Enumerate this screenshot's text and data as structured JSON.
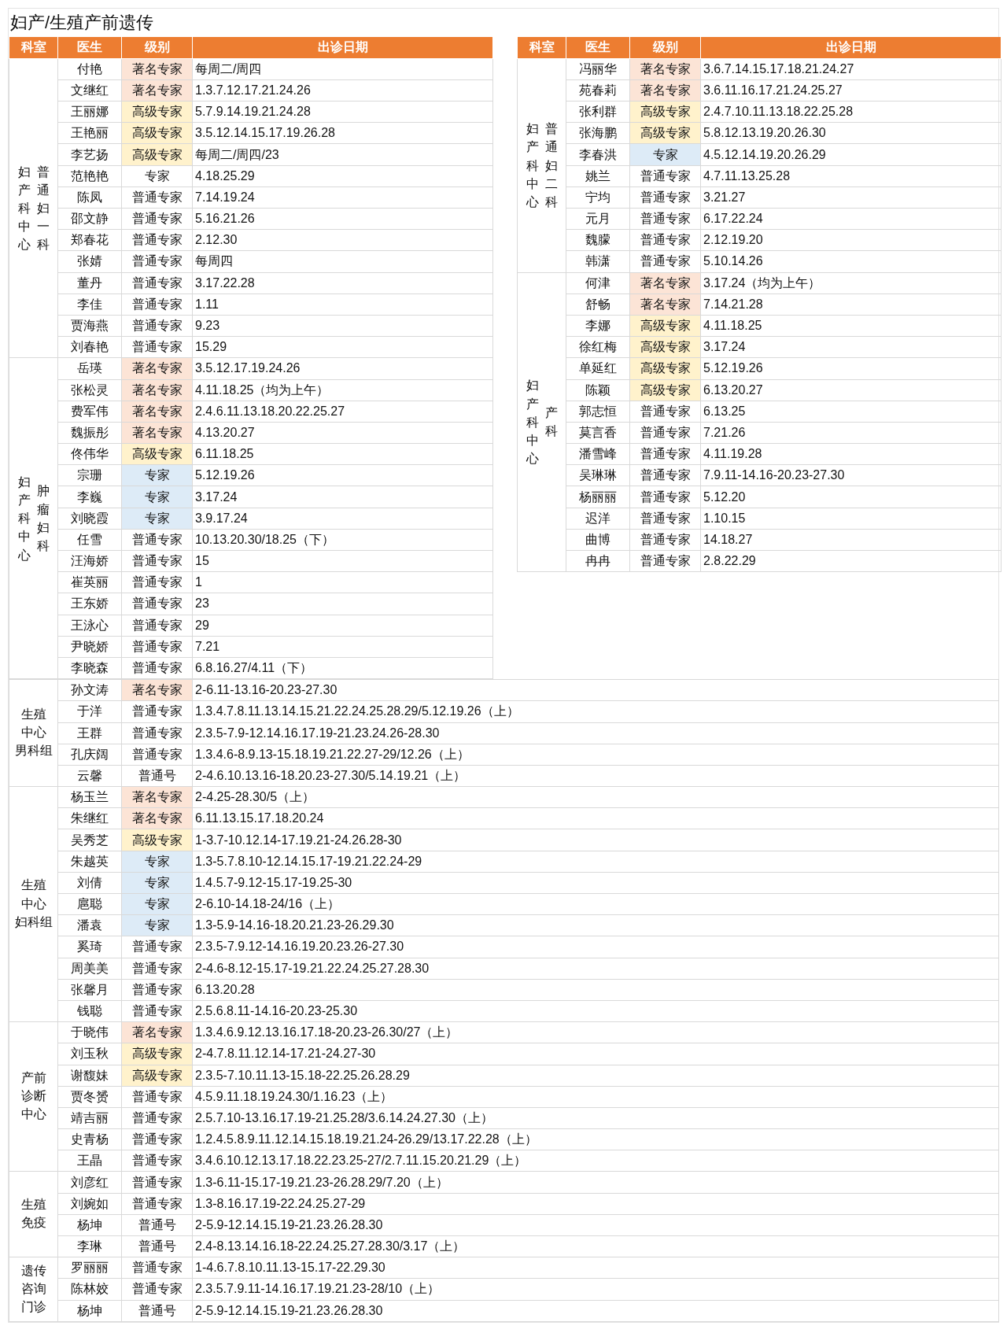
{
  "title": "妇产/生殖产前遗传",
  "top_tables": [
    {
      "columns": [
        "科室",
        "医生",
        "级别",
        "出诊日期"
      ],
      "sections": [
        {
          "department": {
            "kind": "vertical",
            "lines": [
              "妇产科中心",
              "普通妇一科"
            ]
          },
          "doctors": [
            {
              "name": "付艳",
              "grade": "著名专家",
              "color": "#fce4d6",
              "dates": "每周二/周四"
            },
            {
              "name": "文继红",
              "grade": "著名专家",
              "color": "#fce4d6",
              "dates": "1.3.7.12.17.21.24.26"
            },
            {
              "name": "王丽娜",
              "grade": "高级专家",
              "color": "#fff2cc",
              "dates": "5.7.9.14.19.21.24.28"
            },
            {
              "name": "王艳丽",
              "grade": "高级专家",
              "color": "#fff2cc",
              "dates": "3.5.12.14.15.17.19.26.28"
            },
            {
              "name": "李艺扬",
              "grade": "高级专家",
              "color": "#fff2cc",
              "dates": "每周二/周四/23"
            },
            {
              "name": "范艳艳",
              "grade": "专家",
              "dates": "4.18.25.29"
            },
            {
              "name": "陈凤",
              "grade": "普通专家",
              "dates": "7.14.19.24"
            },
            {
              "name": "邵文静",
              "grade": "普通专家",
              "dates": "5.16.21.26"
            },
            {
              "name": "郑春花",
              "grade": "普通专家",
              "dates": "2.12.30"
            },
            {
              "name": "张婧",
              "grade": "普通专家",
              "dates": "每周四"
            },
            {
              "name": "董丹",
              "grade": "普通专家",
              "dates": "3.17.22.28"
            },
            {
              "name": "李佳",
              "grade": "普通专家",
              "dates": "1.11"
            },
            {
              "name": "贾海燕",
              "grade": "普通专家",
              "dates": "9.23"
            },
            {
              "name": "刘春艳",
              "grade": "普通专家",
              "dates": "15.29"
            }
          ]
        },
        {
          "department": {
            "kind": "vertical",
            "lines": [
              "妇产科中心",
              "肿瘤妇科"
            ]
          },
          "doctors": [
            {
              "name": "岳瑛",
              "grade": "著名专家",
              "color": "#fce4d6",
              "dates": "3.5.12.17.19.24.26"
            },
            {
              "name": "张松灵",
              "grade": "著名专家",
              "color": "#fce4d6",
              "dates": "4.11.18.25（均为上午）"
            },
            {
              "name": "费军伟",
              "grade": "著名专家",
              "color": "#fce4d6",
              "dates": "2.4.6.11.13.18.20.22.25.27"
            },
            {
              "name": "魏振彤",
              "grade": "著名专家",
              "color": "#fce4d6",
              "dates": "4.13.20.27"
            },
            {
              "name": "佟伟华",
              "grade": "高级专家",
              "color": "#fff2cc",
              "dates": "6.11.18.25"
            },
            {
              "name": "宗珊",
              "grade": "专家",
              "color": "#ddebf7",
              "dates": "5.12.19.26"
            },
            {
              "name": "李巍",
              "grade": "专家",
              "color": "#ddebf7",
              "dates": "3.17.24"
            },
            {
              "name": "刘晓霞",
              "grade": "专家",
              "color": "#ddebf7",
              "dates": "3.9.17.24"
            },
            {
              "name": "任雪",
              "grade": "普通专家",
              "dates": "10.13.20.30/18.25（下）"
            },
            {
              "name": "汪海娇",
              "grade": "普通专家",
              "dates": "15"
            },
            {
              "name": "崔英丽",
              "grade": "普通专家",
              "dates": "1"
            },
            {
              "name": "王东娇",
              "grade": "普通专家",
              "dates": "23"
            },
            {
              "name": "王泳心",
              "grade": "普通专家",
              "dates": "29"
            },
            {
              "name": "尹晓娇",
              "grade": "普通专家",
              "dates": "7.21"
            },
            {
              "name": "李晓森",
              "grade": "普通专家",
              "dates": "6.8.16.27/4.11（下）"
            }
          ]
        }
      ]
    },
    {
      "columns": [
        "科室",
        "医生",
        "级别",
        "出诊日期"
      ],
      "sections": [
        {
          "department": {
            "kind": "vertical",
            "lines": [
              "妇产科中心",
              "普通妇二科"
            ]
          },
          "doctors": [
            {
              "name": "冯丽华",
              "grade": "著名专家",
              "color": "#fce4d6",
              "dates": "3.6.7.14.15.17.18.21.24.27"
            },
            {
              "name": "苑春莉",
              "grade": "著名专家",
              "color": "#fce4d6",
              "dates": "3.6.11.16.17.21.24.25.27"
            },
            {
              "name": "张利群",
              "grade": "高级专家",
              "color": "#fff2cc",
              "dates": "2.4.7.10.11.13.18.22.25.28"
            },
            {
              "name": "张海鹏",
              "grade": "高级专家",
              "color": "#fff2cc",
              "dates": "5.8.12.13.19.20.26.30"
            },
            {
              "name": "李春洪",
              "grade": "专家",
              "color": "#ddebf7",
              "dates": "4.5.12.14.19.20.26.29"
            },
            {
              "name": "姚兰",
              "grade": "普通专家",
              "dates": "4.7.11.13.25.28"
            },
            {
              "name": "宁均",
              "grade": "普通专家",
              "dates": "3.21.27"
            },
            {
              "name": "元月",
              "grade": "普通专家",
              "dates": "6.17.22.24"
            },
            {
              "name": "魏朦",
              "grade": "普通专家",
              "dates": "2.12.19.20"
            },
            {
              "name": "韩潇",
              "grade": "普通专家",
              "dates": "5.10.14.26"
            }
          ]
        },
        {
          "department": {
            "kind": "vertical",
            "lines": [
              "妇产科中心",
              "产科"
            ]
          },
          "doctors": [
            {
              "name": "何津",
              "grade": "著名专家",
              "color": "#fce4d6",
              "dates": "3.17.24（均为上午）"
            },
            {
              "name": "舒畅",
              "grade": "著名专家",
              "color": "#fce4d6",
              "dates": "7.14.21.28"
            },
            {
              "name": "李娜",
              "grade": "高级专家",
              "color": "#fff2cc",
              "dates": "4.11.18.25"
            },
            {
              "name": "徐红梅",
              "grade": "高级专家",
              "color": "#fff2cc",
              "dates": "3.17.24"
            },
            {
              "name": "单延红",
              "grade": "高级专家",
              "color": "#fff2cc",
              "dates": "5.12.19.26"
            },
            {
              "name": "陈颖",
              "grade": "高级专家",
              "color": "#fff2cc",
              "dates": "6.13.20.27"
            },
            {
              "name": "郭志恒",
              "grade": "普通专家",
              "dates": "6.13.25"
            },
            {
              "name": "莫言香",
              "grade": "普通专家",
              "dates": "7.21.26"
            },
            {
              "name": "潘雪峰",
              "grade": "普通专家",
              "dates": "4.11.19.28"
            },
            {
              "name": "吴琳琳",
              "grade": "普通专家",
              "dates": "7.9.11-14.16-20.23-27.30"
            },
            {
              "name": "杨丽丽",
              "grade": "普通专家",
              "dates": "5.12.20"
            },
            {
              "name": "迟洋",
              "grade": "普通专家",
              "dates": "1.10.15"
            },
            {
              "name": "曲博",
              "grade": "普通专家",
              "dates": "14.18.27"
            },
            {
              "name": "冉冉",
              "grade": "普通专家",
              "dates": "2.8.22.29"
            }
          ]
        }
      ]
    }
  ],
  "bottom_table": {
    "sections": [
      {
        "department": {
          "kind": "stacked",
          "lines": [
            "生殖",
            "中心",
            "男科组"
          ]
        },
        "doctors": [
          {
            "name": "孙文涛",
            "grade": "著名专家",
            "color": "#fce4d6",
            "dates": "2-6.11-13.16-20.23-27.30"
          },
          {
            "name": "于洋",
            "grade": "普通专家",
            "dates": "1.3.4.7.8.11.13.14.15.21.22.24.25.28.29/5.12.19.26（上）"
          },
          {
            "name": "王群",
            "grade": "普通专家",
            "dates": "2.3.5-7.9-12.14.16.17.19-21.23.24.26-28.30"
          },
          {
            "name": "孔庆阔",
            "grade": "普通专家",
            "dates": "1.3.4.6-8.9.13-15.18.19.21.22.27-29/12.26（上）"
          },
          {
            "name": "云馨",
            "grade": "普通号",
            "dates": "2-4.6.10.13.16-18.20.23-27.30/5.14.19.21（上）"
          }
        ]
      },
      {
        "department": {
          "kind": "stacked",
          "lines": [
            "生殖",
            "中心",
            "妇科组"
          ]
        },
        "doctors": [
          {
            "name": "杨玉兰",
            "grade": "著名专家",
            "color": "#fce4d6",
            "dates": "2-4.25-28.30/5（上）"
          },
          {
            "name": "朱继红",
            "grade": "著名专家",
            "color": "#fce4d6",
            "dates": "6.11.13.15.17.18.20.24"
          },
          {
            "name": "吴秀芝",
            "grade": "高级专家",
            "color": "#fff2cc",
            "dates": "1-3.7-10.12.14-17.19.21-24.26.28-30"
          },
          {
            "name": "朱越英",
            "grade": "专家",
            "color": "#ddebf7",
            "dates": "1.3-5.7.8.10-12.14.15.17-19.21.22.24-29"
          },
          {
            "name": "刘倩",
            "grade": "专家",
            "color": "#ddebf7",
            "dates": "1.4.5.7-9.12-15.17-19.25-30"
          },
          {
            "name": "扈聪",
            "grade": "专家",
            "color": "#ddebf7",
            "dates": "2-6.10-14.18-24/16（上）"
          },
          {
            "name": "潘袁",
            "grade": "专家",
            "color": "#ddebf7",
            "dates": "1.3-5.9-14.16-18.20.21.23-26.29.30"
          },
          {
            "name": "奚琦",
            "grade": "普通专家",
            "dates": "2.3.5-7.9.12-14.16.19.20.23.26-27.30"
          },
          {
            "name": "周美美",
            "grade": "普通专家",
            "dates": "2-4.6-8.12-15.17-19.21.22.24.25.27.28.30"
          },
          {
            "name": "张馨月",
            "grade": "普通专家",
            "dates": "6.13.20.28"
          },
          {
            "name": "钱聪",
            "grade": "普通专家",
            "dates": "2.5.6.8.11-14.16-20.23-25.30"
          }
        ]
      },
      {
        "department": {
          "kind": "stacked",
          "lines": [
            "产前",
            "诊断",
            "中心"
          ]
        },
        "doctors": [
          {
            "name": "于晓伟",
            "grade": "著名专家",
            "color": "#fce4d6",
            "dates": "1.3.4.6.9.12.13.16.17.18-20.23-26.30/27（上）"
          },
          {
            "name": "刘玉秋",
            "grade": "高级专家",
            "color": "#fff2cc",
            "dates": "2-4.7.8.11.12.14-17.21-24.27-30"
          },
          {
            "name": "谢馥妹",
            "grade": "高级专家",
            "color": "#fff2cc",
            "dates": "2.3.5-7.10.11.13-15.18-22.25.26.28.29"
          },
          {
            "name": "贾冬赟",
            "grade": "普通专家",
            "dates": "4.5.9.11.18.19.24.30/1.16.23（上）"
          },
          {
            "name": "靖吉丽",
            "grade": "普通专家",
            "dates": "2.5.7.10-13.16.17.19-21.25.28/3.6.14.24.27.30（上）"
          },
          {
            "name": "史青杨",
            "grade": "普通专家",
            "dates": "1.2.4.5.8.9.11.12.14.15.18.19.21.24-26.29/13.17.22.28（上）"
          },
          {
            "name": "王晶",
            "grade": "普通专家",
            "dates": "3.4.6.10.12.13.17.18.22.23.25-27/2.7.11.15.20.21.29（上）"
          }
        ]
      },
      {
        "department": {
          "kind": "stacked",
          "lines": [
            "生殖",
            "免疫"
          ]
        },
        "doctors": [
          {
            "name": "刘彦红",
            "grade": "普通专家",
            "dates": "1.3-6.11-15.17-19.21.23-26.28.29/7.20（上）"
          },
          {
            "name": "刘婉如",
            "grade": "普通专家",
            "dates": "1.3-8.16.17.19-22.24.25.27-29"
          },
          {
            "name": "杨坤",
            "grade": "普通号",
            "dates": "2-5.9-12.14.15.19-21.23.26.28.30"
          },
          {
            "name": "李琳",
            "grade": "普通号",
            "dates": "2.4-8.13.14.16.18-22.24.25.27.28.30/3.17（上）"
          }
        ]
      },
      {
        "department": {
          "kind": "stacked",
          "lines": [
            "遗传",
            "咨询",
            "门诊"
          ]
        },
        "doctors": [
          {
            "name": "罗丽丽",
            "grade": "普通专家",
            "dates": "1-4.6.7.8.10.11.13-15.17-22.29.30"
          },
          {
            "name": "陈林姣",
            "grade": "普通专家",
            "dates": "2.3.5.7.9.11-14.16.17.19.21.23-28/10（上）"
          },
          {
            "name": "杨坤",
            "grade": "普通号",
            "dates": "2-5.9-12.14.15.19-21.23.26.28.30"
          }
        ]
      }
    ]
  }
}
